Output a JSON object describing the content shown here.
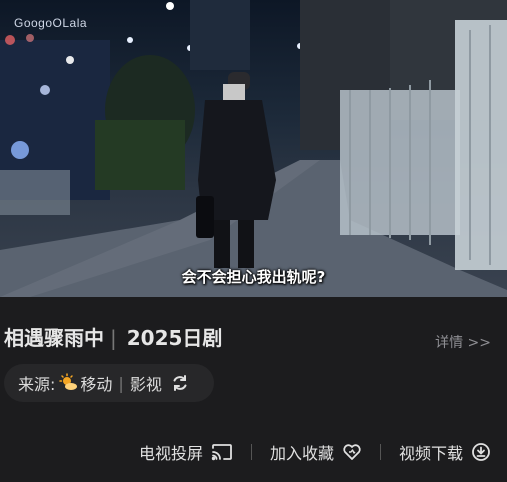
{
  "video": {
    "watermark": "GoogoOLala",
    "subtitle": "会不会担心我出轨呢?"
  },
  "show": {
    "title": "相遇骤雨中",
    "separator": "|",
    "year_genre": "2025日剧",
    "detail_link": "详情 >>"
  },
  "source": {
    "label": "来源:",
    "provider_icon": "sun-cloud-icon",
    "provider_name": "移动",
    "separator": "|",
    "category": "影视",
    "switch_icon": "refresh-icon"
  },
  "actions": {
    "cast_label": "电视投屏",
    "cast_icon": "cast-icon",
    "favorite_label": "加入收藏",
    "favorite_icon": "heart-icon",
    "download_label": "视频下载",
    "download_icon": "download-icon"
  },
  "colors": {
    "background": "#1c1c1e",
    "pill": "#272729",
    "muted_text": "#8e8e93",
    "sun": "#f5a623"
  }
}
